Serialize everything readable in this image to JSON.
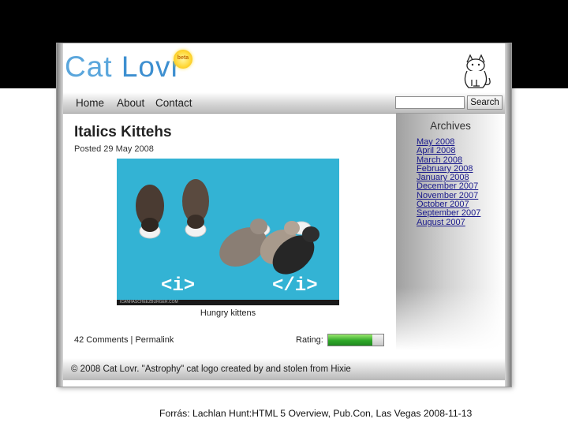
{
  "site": {
    "logo_part1": "Cat ",
    "logo_part2": "Lovr",
    "logo_badge": "beta"
  },
  "nav": {
    "items": [
      "Home",
      "About",
      "Contact"
    ],
    "search_value": "",
    "search_button": "Search"
  },
  "post": {
    "title": "Italics Kittehs",
    "date": "Posted 29 May 2008",
    "photo_code_left": "<i>",
    "photo_code_right": "</i>",
    "photo_credit": "ICANHASCHEEZBURGER.COM",
    "caption": "Hungry kittens",
    "comments_link": "42 Comments",
    "separator": "|",
    "permalink": "Permalink",
    "rating_label": "Rating:",
    "rating_fraction": 0.8
  },
  "sidebar": {
    "title": "Archives",
    "items": [
      "May 2008",
      "April 2008",
      "March 2008",
      "February 2008",
      "January 2008",
      "December 2007",
      "November 2007",
      "October 2007",
      "September 2007",
      "August 2007"
    ]
  },
  "footer": {
    "text": "© 2008 Cat Lovr. \"Astrophy\" cat logo created by and stolen from Hixie"
  },
  "source_caption": "Forrás: Lachlan Hunt:HTML 5 Overview, Pub.Con, Las Vegas 2008-11-13",
  "colors": {
    "logo_blue": "#5aa6dc",
    "photo_bg": "#33b3d4",
    "link": "#1a1a8c",
    "rating_green": "#2fa82a"
  }
}
